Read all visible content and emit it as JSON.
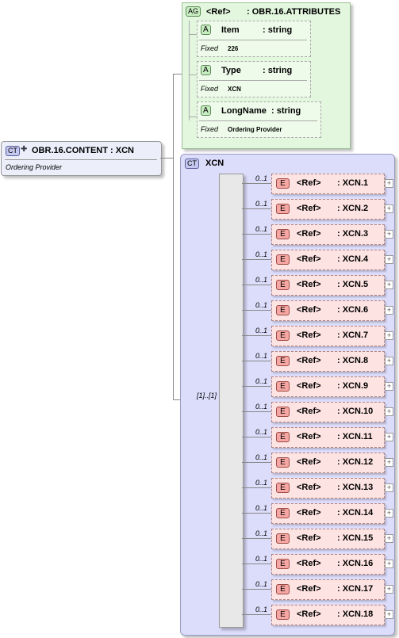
{
  "root": {
    "badge": "CT",
    "name": "OBR.16.CONTENT : XCN",
    "doc": "Ordering Provider"
  },
  "attribute_group": {
    "badge": "AG",
    "ref": "<Ref>",
    "name": ": OBR.16.ATTRIBUTES",
    "attributes": [
      {
        "badge": "A",
        "name": "Item",
        "type": ": string",
        "fixed_label": "Fixed",
        "fixed_value": "226"
      },
      {
        "badge": "A",
        "name": "Type",
        "type": ": string",
        "fixed_label": "Fixed",
        "fixed_value": "XCN"
      },
      {
        "badge": "A",
        "name": "LongName",
        "type": ": string",
        "fixed_label": "Fixed",
        "fixed_value": "Ordering Provider"
      }
    ]
  },
  "complex_type": {
    "badge": "CT",
    "name": "XCN",
    "sequence_multiplicity": "[1]..[1]",
    "elements": [
      {
        "mult": "0..1",
        "badge": "E",
        "ref": "<Ref>",
        "name": ": XCN.1"
      },
      {
        "mult": "0..1",
        "badge": "E",
        "ref": "<Ref>",
        "name": ": XCN.2"
      },
      {
        "mult": "0..1",
        "badge": "E",
        "ref": "<Ref>",
        "name": ": XCN.3"
      },
      {
        "mult": "0..1",
        "badge": "E",
        "ref": "<Ref>",
        "name": ": XCN.4"
      },
      {
        "mult": "0..1",
        "badge": "E",
        "ref": "<Ref>",
        "name": ": XCN.5"
      },
      {
        "mult": "0..1",
        "badge": "E",
        "ref": "<Ref>",
        "name": ": XCN.6"
      },
      {
        "mult": "0..1",
        "badge": "E",
        "ref": "<Ref>",
        "name": ": XCN.7"
      },
      {
        "mult": "0..1",
        "badge": "E",
        "ref": "<Ref>",
        "name": ": XCN.8"
      },
      {
        "mult": "0..1",
        "badge": "E",
        "ref": "<Ref>",
        "name": ": XCN.9"
      },
      {
        "mult": "0..1",
        "badge": "E",
        "ref": "<Ref>",
        "name": ": XCN.10"
      },
      {
        "mult": "0..1",
        "badge": "E",
        "ref": "<Ref>",
        "name": ": XCN.11"
      },
      {
        "mult": "0..1",
        "badge": "E",
        "ref": "<Ref>",
        "name": ": XCN.12"
      },
      {
        "mult": "0..1",
        "badge": "E",
        "ref": "<Ref>",
        "name": ": XCN.13"
      },
      {
        "mult": "0..1",
        "badge": "E",
        "ref": "<Ref>",
        "name": ": XCN.14"
      },
      {
        "mult": "0..1",
        "badge": "E",
        "ref": "<Ref>",
        "name": ": XCN.15"
      },
      {
        "mult": "0..1",
        "badge": "E",
        "ref": "<Ref>",
        "name": ": XCN.16"
      },
      {
        "mult": "0..1",
        "badge": "E",
        "ref": "<Ref>",
        "name": ": XCN.17"
      },
      {
        "mult": "0..1",
        "badge": "E",
        "ref": "<Ref>",
        "name": ": XCN.18"
      }
    ]
  },
  "colors": {
    "ag_bg": "#e3f7df",
    "ct_bg": "#dcdcfb",
    "e_bg": "#fde3e1",
    "seq_bar": "#e8e8e8"
  }
}
